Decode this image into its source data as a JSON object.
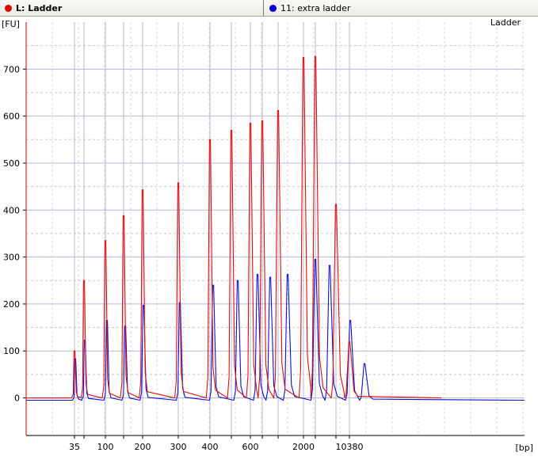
{
  "tabs": [
    {
      "label": "L: Ladder",
      "color": "#e00000",
      "active": true
    },
    {
      "label": "11: extra ladder",
      "color": "#0000cc",
      "active": false
    }
  ],
  "colors": {
    "grid": "#b4bad6",
    "minor_grid": "#c8c8c8",
    "axis": "#cc0000",
    "ladder": "#e01010",
    "sample": "#1010d0"
  },
  "chart_data": {
    "type": "line",
    "title": "Ladder",
    "ylabel": "[FU]",
    "xlabel": "[bp]",
    "ylim": [
      -80,
      800
    ],
    "y_ticks": [
      0,
      100,
      200,
      300,
      400,
      500,
      600,
      700
    ],
    "x_tick_labels": [
      "35",
      "100",
      "200",
      "300",
      "400",
      "600",
      "2000",
      "10380"
    ],
    "marker_lines": [
      "35",
      "50",
      "100",
      "150",
      "200",
      "300",
      "400",
      "500",
      "600",
      "700",
      "1000",
      "2000",
      "3000",
      "7000",
      "10380"
    ],
    "series": [
      {
        "name": "L: Ladder",
        "baseline": 0,
        "peaks": [
          {
            "bp": "35",
            "height": 100
          },
          {
            "bp": "50",
            "height": 250
          },
          {
            "bp": "100",
            "height": 335
          },
          {
            "bp": "150",
            "height": 388
          },
          {
            "bp": "200",
            "height": 443
          },
          {
            "bp": "300",
            "height": 458
          },
          {
            "bp": "400",
            "height": 550
          },
          {
            "bp": "500",
            "height": 570
          },
          {
            "bp": "600",
            "height": 585
          },
          {
            "bp": "700",
            "height": 590
          },
          {
            "bp": "1000",
            "height": 612
          },
          {
            "bp": "2000",
            "height": 725
          },
          {
            "bp": "3000",
            "height": 727
          },
          {
            "bp": "7000",
            "height": 412
          },
          {
            "bp": "10380",
            "height": 120
          }
        ]
      },
      {
        "name": "11: extra ladder",
        "baseline": -5,
        "peaks": [
          {
            "bp": "35",
            "height": 88
          },
          {
            "bp": "50",
            "height": 128
          },
          {
            "bp": "100",
            "height": 170
          },
          {
            "bp": "150",
            "height": 158
          },
          {
            "bp": "200",
            "height": 202
          },
          {
            "bp": "300",
            "height": 208
          },
          {
            "bp": "400",
            "height": 245
          },
          {
            "bp": "500",
            "height": 255
          },
          {
            "bp": "600",
            "height": 268
          },
          {
            "bp": "700",
            "height": 262
          },
          {
            "bp": "1000",
            "height": 268
          },
          {
            "bp": "2000",
            "height": 300
          },
          {
            "bp": "3000",
            "height": 287
          },
          {
            "bp": "7000",
            "height": 170
          },
          {
            "bp": "10380",
            "height": 78
          }
        ]
      }
    ]
  }
}
